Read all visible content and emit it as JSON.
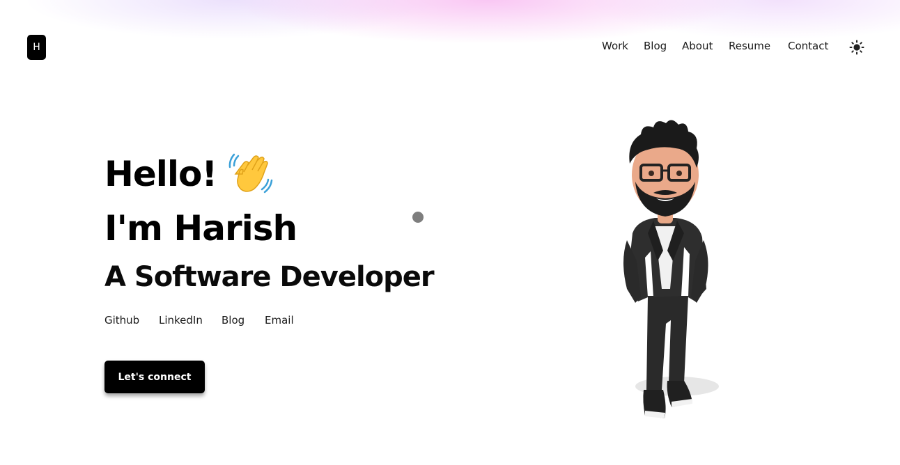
{
  "header": {
    "logo_letter": "H",
    "nav": [
      "Work",
      "Blog",
      "About",
      "Resume",
      "Contact"
    ],
    "theme_icon": "sun-icon"
  },
  "hero": {
    "greeting": "Hello!",
    "wave_icon": "waving-hand-icon",
    "name_line": "I'm Harish",
    "role": "A Software Developer",
    "links": [
      "Github",
      "LinkedIn",
      "Blog",
      "Email"
    ],
    "cta_label": "Let's connect"
  },
  "colors": {
    "text": "#000000",
    "button_bg": "#000000",
    "button_text": "#ffffff",
    "glow_pink": "#f7b4f0",
    "cursor_dot": "#7e7e7e"
  }
}
